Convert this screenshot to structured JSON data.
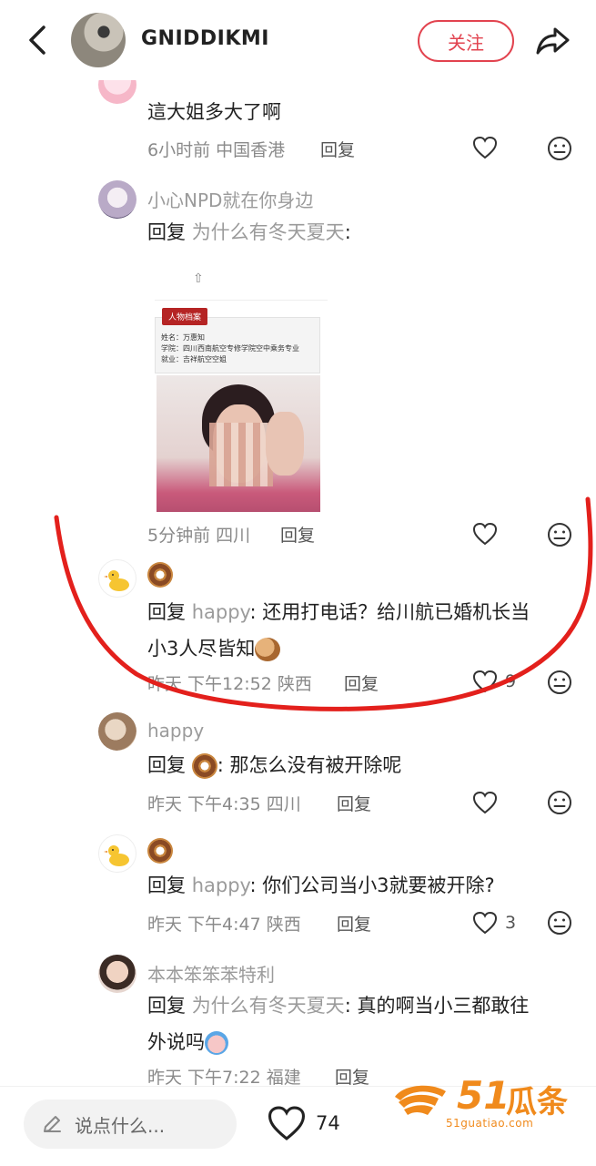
{
  "header": {
    "title": "GNIDDIKMI",
    "follow_label": "关注"
  },
  "comments": [
    {
      "text": "這大姐多大了啊",
      "meta": "6小时前 中国香港",
      "reply_label": "回复"
    },
    {
      "username": "小心NPD就在你身边",
      "reply_prefix": "回复",
      "reply_to": "为什么有冬天夏天",
      "text": ":",
      "meta": "5分钟前 四川",
      "reply_label": "回复",
      "image": {
        "tag": "人物档案",
        "line1": "姓名：万惠知",
        "line2": "学院：四川西南航空专修学院空中乘务专业",
        "line3": "就业：吉祥航空空姐"
      }
    },
    {
      "reply_prefix": "回复",
      "reply_to": "happy",
      "text_line1": ": 还用打电话？给川航已婚机长当",
      "text_line2": "小3人尽皆知",
      "meta": "昨天 下午12:52 陕西",
      "reply_label": "回复",
      "likes": "9"
    },
    {
      "username": "happy",
      "reply_prefix": "回复",
      "text": ": 那怎么没有被开除呢",
      "meta": "昨天 下午4:35 四川",
      "reply_label": "回复"
    },
    {
      "reply_prefix": "回复",
      "reply_to": "happy",
      "text": ": 你们公司当小3就要被开除?",
      "meta": "昨天 下午4:47 陕西",
      "reply_label": "回复",
      "likes": "3"
    },
    {
      "username": "本本笨笨苯特利",
      "reply_prefix": "回复",
      "reply_to": "为什么有冬天夏天",
      "text_line1": ": 真的啊当小三都敢往",
      "text_line2": "外说吗",
      "meta": "昨天 下午7:22 福建",
      "reply_label": "回复"
    }
  ],
  "bottom": {
    "input_placeholder": "说点什么...",
    "like_count": "74"
  },
  "watermark": {
    "number": "51",
    "text": "瓜条",
    "url": "51guatiao.com"
  },
  "colors": {
    "accent": "#e2434f",
    "annotation": "#e3201c",
    "watermark": "#f08a1c"
  }
}
